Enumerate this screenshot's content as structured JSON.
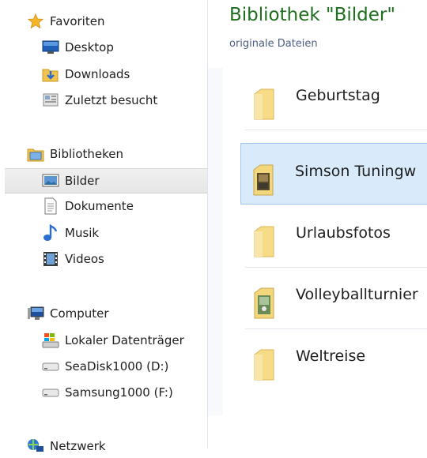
{
  "navigation": {
    "favorites": {
      "label": "Favoriten",
      "items": [
        {
          "label": "Desktop",
          "icon": "desktop-icon"
        },
        {
          "label": "Downloads",
          "icon": "downloads-folder-icon"
        },
        {
          "label": "Zuletzt besucht",
          "icon": "recent-places-icon"
        }
      ]
    },
    "libraries": {
      "label": "Bibliotheken",
      "items": [
        {
          "label": "Bilder",
          "icon": "pictures-library-icon",
          "selected": true
        },
        {
          "label": "Dokumente",
          "icon": "documents-library-icon"
        },
        {
          "label": "Musik",
          "icon": "music-library-icon"
        },
        {
          "label": "Videos",
          "icon": "videos-library-icon"
        }
      ]
    },
    "computer": {
      "label": "Computer",
      "items": [
        {
          "label": "Lokaler Datenträger",
          "icon": "local-disk-icon"
        },
        {
          "label": "SeaDisk1000 (D:)",
          "icon": "drive-icon"
        },
        {
          "label": "Samsung1000 (F:)",
          "icon": "drive-icon"
        }
      ]
    },
    "network": {
      "label": "Netzwerk"
    }
  },
  "library": {
    "title": "Bibliothek \"Bilder\"",
    "subtitle": "originale Dateien"
  },
  "files": [
    {
      "name": "Geburtstag",
      "type": "folder"
    },
    {
      "name": "Simson Tuningw",
      "type": "image-folder",
      "selected": true
    },
    {
      "name": "Urlaubsfotos",
      "type": "folder"
    },
    {
      "name": "Volleyballturnier",
      "type": "image-folder"
    },
    {
      "name": "Weltreise",
      "type": "folder"
    }
  ],
  "colors": {
    "title": "#1e6e1e",
    "subtitle": "#4d6082",
    "selection": "#d9ebfb",
    "folder": "#f3d77c"
  }
}
